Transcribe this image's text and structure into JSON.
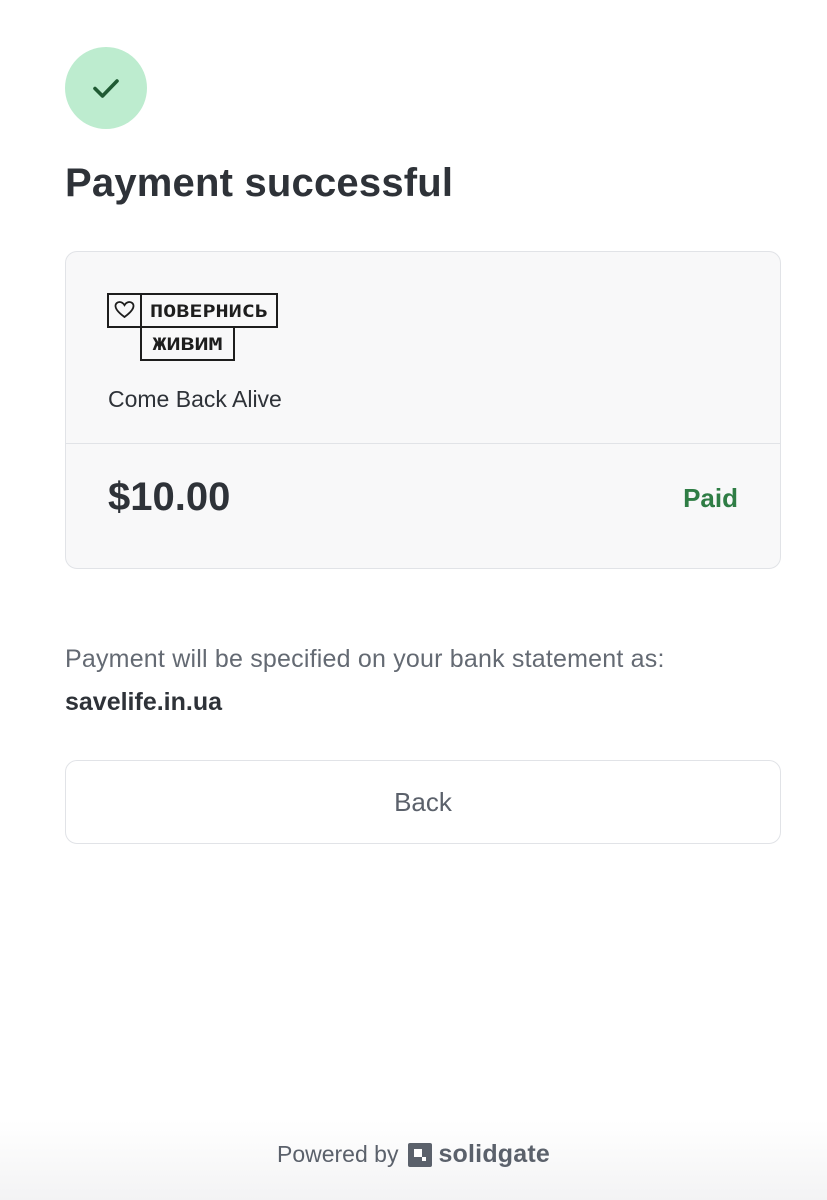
{
  "header": {
    "icon": "checkmark-icon",
    "title": "Payment successful",
    "accent_color": "#bdeccf",
    "check_color": "#1f5a33"
  },
  "merchant": {
    "logo_line1": "ПОВЕРНИСЬ",
    "logo_line2": "ЖИВИМ",
    "name": "Come Back Alive"
  },
  "payment": {
    "amount": "$10.00",
    "status": "Paid",
    "status_color": "#2f7d45"
  },
  "statement": {
    "label": "Payment will be specified on your bank statement as:",
    "descriptor": "savelife.in.ua"
  },
  "actions": {
    "back_label": "Back"
  },
  "footer": {
    "powered_by": "Powered by",
    "brand": "solidgate",
    "brand_icon": "solidgate-logo-icon"
  }
}
